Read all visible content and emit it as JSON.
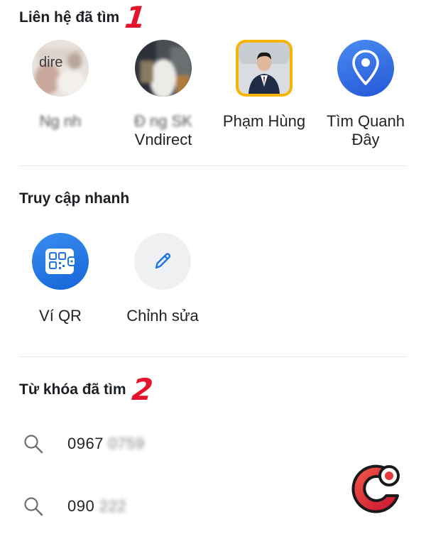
{
  "recent_contacts": {
    "title": "Liên hệ đã tìm",
    "marker": "1",
    "items": [
      {
        "name_line1": "Ng    nh",
        "name_line2": "",
        "avatar_text": "dire",
        "blurred": true
      },
      {
        "name_line1": "Đ  ng SK",
        "name_line2": "Vndirect",
        "avatar_text": "",
        "blurred": true
      },
      {
        "name_line1": "Phạm Hùng",
        "name_line2": "",
        "avatar_text": "",
        "blurred": false
      },
      {
        "name_line1": "Tìm Quanh",
        "name_line2": "Đây",
        "avatar_text": "",
        "blurred": false
      }
    ]
  },
  "quick_access": {
    "title": "Truy cập nhanh",
    "items": [
      {
        "label": "Ví QR",
        "icon": "qr-wallet-icon"
      },
      {
        "label": "Chỉnh sửa",
        "icon": "pencil-icon"
      }
    ]
  },
  "recent_keywords": {
    "title": "Từ khóa đã tìm",
    "marker": "2",
    "items": [
      {
        "visible": "0967",
        "hidden": "   0759"
      },
      {
        "visible": "090",
        "hidden": "     222"
      }
    ]
  },
  "colors": {
    "marker_red": "#e3142b",
    "accent_blue": "#1e74e6",
    "edit_circle": "#eef0f2",
    "logo_red": "#e8393c"
  }
}
